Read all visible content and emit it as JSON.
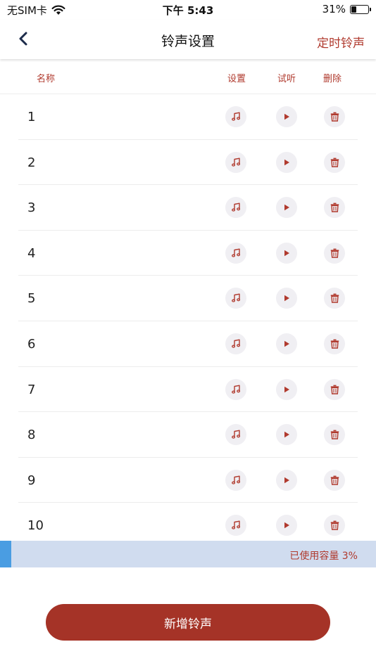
{
  "status_bar": {
    "carrier": "无SIM卡",
    "time": "下午 5:43",
    "battery_text": "31%",
    "battery_level": 0.31
  },
  "nav": {
    "title": "铃声设置",
    "right_action": "定时铃声"
  },
  "columns": {
    "name": "名称",
    "settings": "设置",
    "listen": "试听",
    "delete": "删除"
  },
  "rows": [
    {
      "name": "1"
    },
    {
      "name": "2"
    },
    {
      "name": "3"
    },
    {
      "name": "4"
    },
    {
      "name": "5"
    },
    {
      "name": "6"
    },
    {
      "name": "7"
    },
    {
      "name": "8"
    },
    {
      "name": "9"
    },
    {
      "name": "10"
    }
  ],
  "capacity": {
    "label": "已使用容量 3%",
    "used_fraction": 0.03
  },
  "add_button": {
    "label": "新增铃声"
  },
  "colors": {
    "accent": "#b03a2e",
    "button": "#a53327",
    "capacity_track": "#d0dcef",
    "capacity_fill": "#4a9de2",
    "icon_bg": "#f0eff3"
  }
}
